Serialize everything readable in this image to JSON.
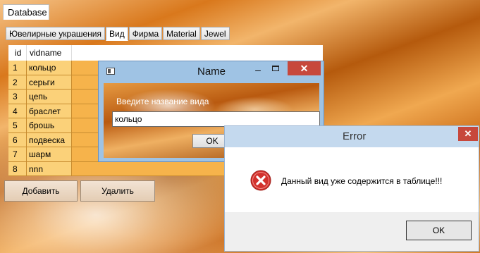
{
  "main": {
    "top_tab": "Database",
    "tabs": [
      {
        "label": "Ювелирные украшения"
      },
      {
        "label": "Вид"
      },
      {
        "label": "Фирма"
      },
      {
        "label": "Material"
      },
      {
        "label": "Jewel"
      }
    ],
    "active_tab": "Вид",
    "grid": {
      "columns": [
        "id",
        "vidname"
      ],
      "rows": [
        {
          "id": "1",
          "vidname": "кольцо"
        },
        {
          "id": "2",
          "vidname": "серьги"
        },
        {
          "id": "3",
          "vidname": "цепь"
        },
        {
          "id": "4",
          "vidname": "браслет"
        },
        {
          "id": "5",
          "vidname": "брошь"
        },
        {
          "id": "6",
          "vidname": "подвеска"
        },
        {
          "id": "7",
          "vidname": "шарм"
        },
        {
          "id": "8",
          "vidname": "nnn"
        }
      ]
    },
    "buttons": {
      "add": "Добавить",
      "delete": "Удалить"
    }
  },
  "name_dialog": {
    "title": "Name",
    "minimize": "–",
    "close": "✕",
    "prompt": "Введите название вида",
    "input_value": "кольцо",
    "ok": "OK"
  },
  "error_dialog": {
    "title": "Error",
    "close": "✕",
    "message": "Данный вид уже содержится в таблице!!!",
    "ok": "OK"
  },
  "colors": {
    "row_cell": "#fbd179",
    "row_fill": "#f6b34b",
    "close_button": "#c7483c",
    "error_icon": "#d2322d"
  }
}
